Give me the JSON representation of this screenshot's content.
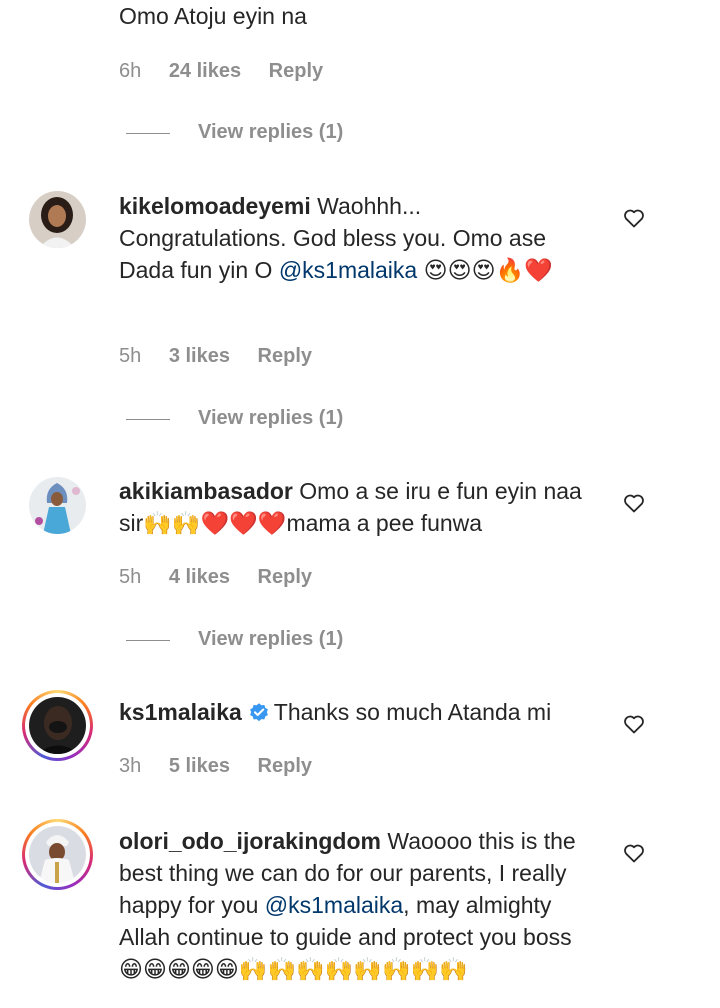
{
  "comments": [
    {
      "text": "Omo Atoju eyin na",
      "time": "6h",
      "likes": "24 likes",
      "reply": "Reply",
      "view_replies": "View replies (1)"
    },
    {
      "username": "kikelomoadeyemi",
      "text_a": "Waohhh... Congratulations. God bless you. Omo ase Dada fun yin O",
      "mention": "@ks1malaika",
      "text_b": "😍😍😍🔥❤️",
      "time": "5h",
      "likes": "3 likes",
      "reply": "Reply",
      "view_replies": "View replies (1)"
    },
    {
      "username": "akikiambasador",
      "text": "Omo a se iru e fun eyin naa sir🙌🙌❤️❤️❤️mama a pee funwa",
      "time": "5h",
      "likes": "4 likes",
      "reply": "Reply",
      "view_replies": "View replies (1)"
    },
    {
      "username": "ks1malaika",
      "text": "Thanks so much Atanda mi",
      "time": "3h",
      "likes": "5 likes",
      "reply": "Reply"
    },
    {
      "username": "olori_odo_ijorakingdom",
      "text_a": "Waoooo this is the best thing we can do for our parents, I really happy for you",
      "mention": "@ks1malaika",
      "text_b": ", may almighty Allah continue to guide and protect you boss😁😁😁😁😁🙌🙌🙌🙌🙌🙌🙌🙌"
    }
  ],
  "icons": {
    "heart": "heart-outline-icon",
    "verified": "verified-badge-icon"
  },
  "colors": {
    "text": "#262626",
    "meta": "#8e8e8e",
    "mention": "#00376b",
    "verified": "#3897f0"
  }
}
